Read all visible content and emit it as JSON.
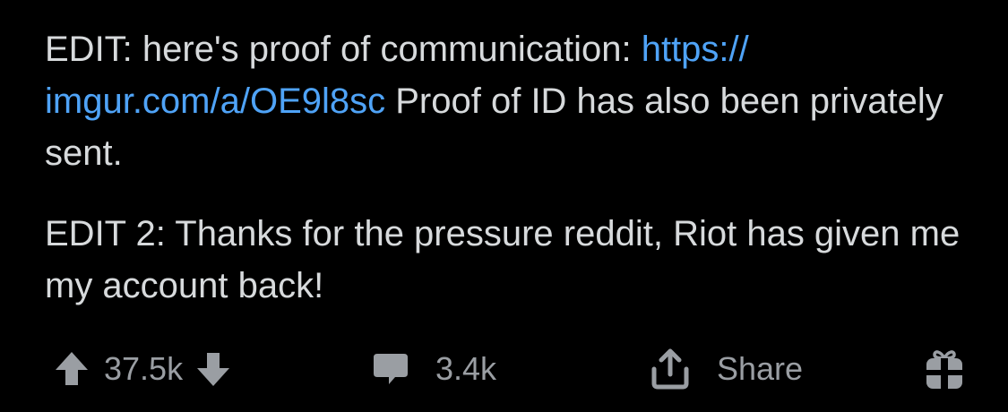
{
  "post": {
    "edit1_prefix": "EDIT: here's proof of communication: ",
    "edit1_link_line1": "https://",
    "edit1_link_line2": "imgur.com/a/OE9l8sc",
    "edit1_suffix": " Proof of ID has also been privately sent.",
    "edit2": "EDIT 2: Thanks for the pressure reddit, Riot has given me my account back!"
  },
  "actions": {
    "vote_count": "37.5k",
    "comment_count": "3.4k",
    "share_label": "Share"
  },
  "icons": {
    "upvote": "arrow-up-icon",
    "downvote": "arrow-down-icon",
    "comment": "comment-bubble-icon",
    "share": "share-upload-icon",
    "award": "gift-award-icon"
  },
  "colors": {
    "background": "#000000",
    "text": "#d7dadc",
    "link": "#4fa3f7",
    "action": "#9a9ea3"
  }
}
